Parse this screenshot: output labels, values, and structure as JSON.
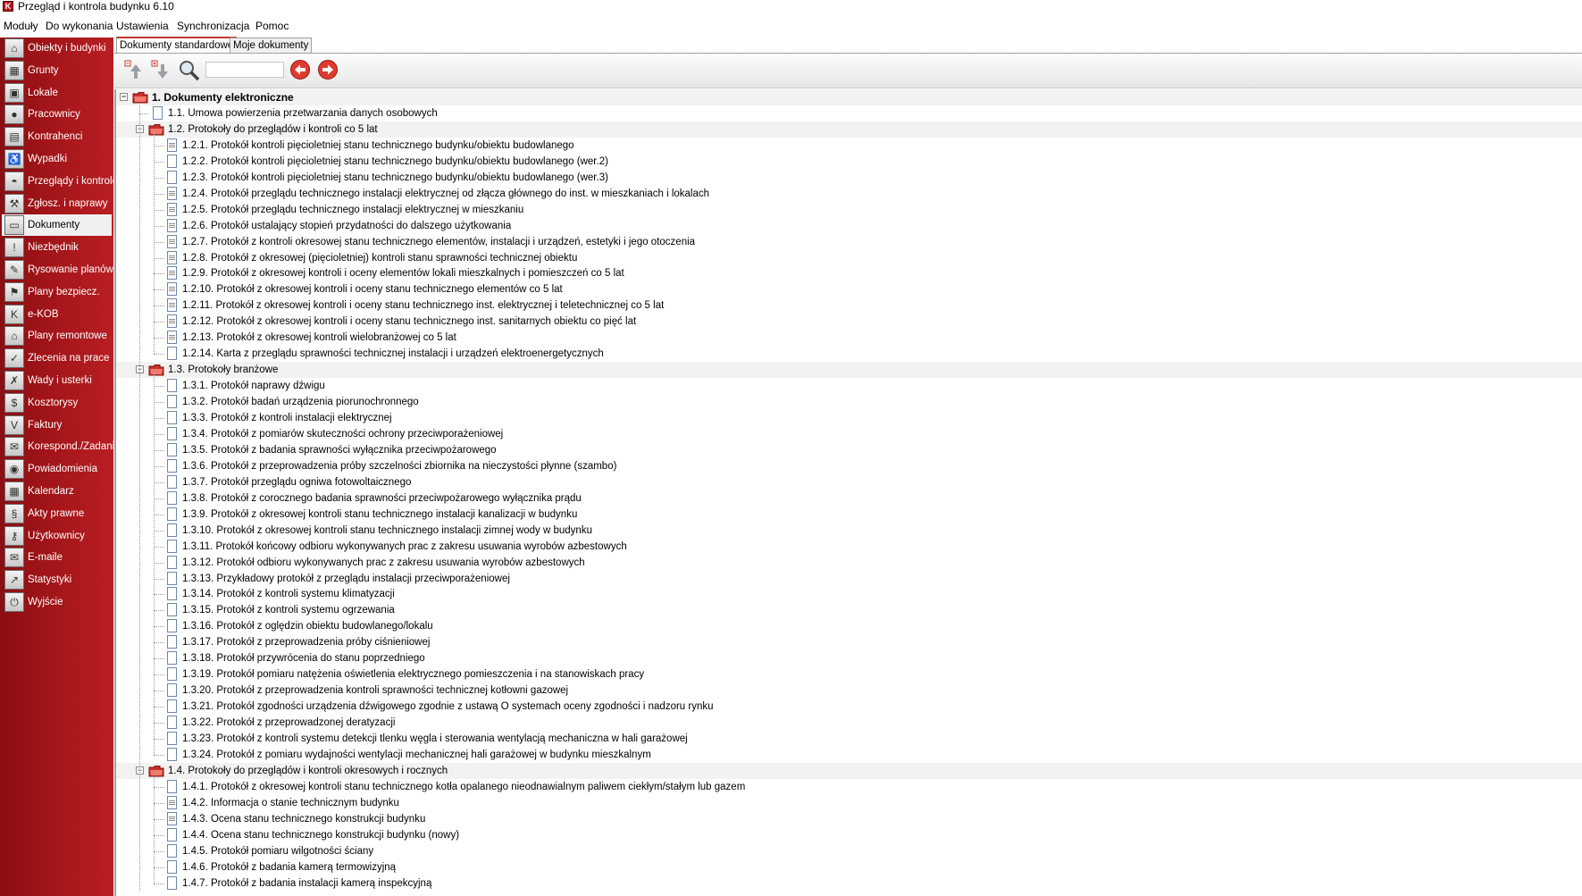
{
  "window": {
    "title": "Przegląd i kontrola budynku  6.10",
    "icon": "app-logo-icon"
  },
  "menu": [
    "Moduły",
    "Do wykonania",
    "Ustawienia",
    "Synchronizacja",
    "Pomoc"
  ],
  "sidebar": {
    "items": [
      {
        "label": "Obiekty i budynki",
        "icon": "building-icon"
      },
      {
        "label": "Grunty",
        "icon": "land-icon"
      },
      {
        "label": "Lokale",
        "icon": "flat-icon"
      },
      {
        "label": "Pracownicy",
        "icon": "person-icon"
      },
      {
        "label": "Kontrahenci",
        "icon": "contractor-icon"
      },
      {
        "label": "Wypadki",
        "icon": "wheelchair-icon"
      },
      {
        "label": "Przeglądy i kontrole",
        "icon": "helmet-icon"
      },
      {
        "label": "Zgłosz. i naprawy",
        "icon": "wrench-icon"
      },
      {
        "label": "Dokumenty",
        "icon": "document-icon",
        "active": true
      },
      {
        "label": "Niezbędnik",
        "icon": "exclamation-book-icon"
      },
      {
        "label": "Rysowanie planów",
        "icon": "drawing-icon"
      },
      {
        "label": "Plany bezpiecz.",
        "icon": "safety-plan-icon"
      },
      {
        "label": "e-KOB",
        "icon": "ekob-icon"
      },
      {
        "label": "Plany remontowe",
        "icon": "renovation-icon"
      },
      {
        "label": "Zlecenia na prace",
        "icon": "work-order-icon"
      },
      {
        "label": "Wady i usterki",
        "icon": "defect-icon"
      },
      {
        "label": "Kosztorysy",
        "icon": "dollar-icon"
      },
      {
        "label": "Faktury",
        "icon": "invoice-icon"
      },
      {
        "label": "Korespond./Zadania",
        "icon": "envelope-icon"
      },
      {
        "label": "Powiadomienia",
        "icon": "notification-icon"
      },
      {
        "label": "Kalendarz",
        "icon": "calendar-icon"
      },
      {
        "label": "Akty prawne",
        "icon": "paragraph-icon"
      },
      {
        "label": "Użytkownicy",
        "icon": "key-icon"
      },
      {
        "label": "E-maile",
        "icon": "email-icon"
      },
      {
        "label": "Statystyki",
        "icon": "chart-icon"
      },
      {
        "label": "Wyjście",
        "icon": "power-icon"
      }
    ]
  },
  "tabs": [
    {
      "label": "Dokumenty standardowe",
      "active": true
    },
    {
      "label": "Moje dokumenty",
      "active": false
    }
  ],
  "toolbar": {
    "buttons": [
      "expand-up-icon",
      "collapse-down-icon",
      "search-icon"
    ],
    "search_value": "",
    "nav": [
      "back-arrow-icon",
      "forward-arrow-icon"
    ]
  },
  "tree": [
    {
      "level": 1,
      "text": "1. Dokumenty elektroniczne",
      "type": "folder"
    },
    {
      "level": 2,
      "text": "1.1. Umowa powierzenia przetwarzania danych osobowych",
      "type": "doc"
    },
    {
      "level": 2,
      "text": "1.2. Protokoły do przeglądów i kontroli co 5 lat",
      "type": "folder"
    },
    {
      "level": 3,
      "text": "1.2.1. Protokół kontroli pięcioletniej stanu technicznego budynku/obiektu budowlanego",
      "type": "docf"
    },
    {
      "level": 3,
      "text": "1.2.2. Protokół kontroli pięcioletniej stanu technicznego budynku/obiektu budowlanego (wer.2)",
      "type": "doc"
    },
    {
      "level": 3,
      "text": "1.2.3. Protokół kontroli pięcioletniej stanu technicznego budynku/obiektu budowlanego (wer.3)",
      "type": "doc"
    },
    {
      "level": 3,
      "text": "1.2.4. Protokół przeglądu technicznego instalacji elektrycznej od złącza głównego do inst. w mieszkaniach i lokalach",
      "type": "docf"
    },
    {
      "level": 3,
      "text": "1.2.5. Protokół przeglądu technicznego instalacji elektrycznej w mieszkaniu",
      "type": "docf"
    },
    {
      "level": 3,
      "text": "1.2.6. Protokół ustalający stopień przydatności do dalszego użytkowania",
      "type": "docf"
    },
    {
      "level": 3,
      "text": "1.2.7. Protokół z kontroli okresowej stanu technicznego elementów, instalacji i urządzeń, estetyki i jego otoczenia",
      "type": "docf"
    },
    {
      "level": 3,
      "text": "1.2.8. Protokół z okresowej (pięcioletniej) kontroli stanu sprawności technicznej obiektu",
      "type": "docf"
    },
    {
      "level": 3,
      "text": "1.2.9. Protokół z okresowej kontroli i oceny elementów lokali mieszkalnych i pomieszczeń co 5 lat",
      "type": "docf"
    },
    {
      "level": 3,
      "text": "1.2.10. Protokół z okresowej kontroli i oceny stanu technicznego elementów co 5 lat",
      "type": "docf"
    },
    {
      "level": 3,
      "text": "1.2.11. Protokół z okresowej kontroli i oceny stanu technicznego inst. elektrycznej i teletechnicznej co 5 lat",
      "type": "docf"
    },
    {
      "level": 3,
      "text": "1.2.12. Protokół z okresowej kontroli i oceny stanu technicznego inst. sanitarnych obiektu co pięć lat",
      "type": "docf"
    },
    {
      "level": 3,
      "text": "1.2.13. Protokół z okresowej kontroli wielobranżowej co 5 lat",
      "type": "docf"
    },
    {
      "level": 3,
      "text": "1.2.14. Karta z przeglądu sprawności technicznej instalacji i urządzeń elektroenergetycznych",
      "type": "doc"
    },
    {
      "level": 2,
      "text": "1.3. Protokoły branżowe",
      "type": "folder"
    },
    {
      "level": 3,
      "text": "1.3.1. Protokół naprawy dźwigu",
      "type": "doc"
    },
    {
      "level": 3,
      "text": "1.3.2. Protokół badań urządzenia piorunochronnego",
      "type": "doc"
    },
    {
      "level": 3,
      "text": "1.3.3. Protokół z kontroli instalacji elektrycznej",
      "type": "doc"
    },
    {
      "level": 3,
      "text": "1.3.4. Protokół z pomiarów skuteczności ochrony przeciwporażeniowej",
      "type": "doc"
    },
    {
      "level": 3,
      "text": "1.3.5. Protokół z badania sprawności wyłącznika przeciwpożarowego",
      "type": "doc"
    },
    {
      "level": 3,
      "text": "1.3.6. Protokół z przeprowadzenia próby szczelności zbiornika na nieczystości płynne (szambo)",
      "type": "doc"
    },
    {
      "level": 3,
      "text": "1.3.7. Protokół przeglądu ogniwa fotowoltaicznego",
      "type": "doc"
    },
    {
      "level": 3,
      "text": "1.3.8. Protokół z corocznego badania sprawności przeciwpożarowego wyłącznika prądu",
      "type": "doc"
    },
    {
      "level": 3,
      "text": "1.3.9. Protokół z okresowej kontroli stanu technicznego instalacji kanalizacji w budynku",
      "type": "doc"
    },
    {
      "level": 3,
      "text": "1.3.10. Protokół z okresowej kontroli stanu technicznego instalacji zimnej wody w budynku",
      "type": "doc"
    },
    {
      "level": 3,
      "text": "1.3.11. Protokół końcowy odbioru wykonywanych prac z zakresu usuwania wyrobów azbestowych",
      "type": "doc"
    },
    {
      "level": 3,
      "text": "1.3.12. Protokół odbioru wykonywanych prac z zakresu usuwania wyrobów azbestowych",
      "type": "doc"
    },
    {
      "level": 3,
      "text": "1.3.13. Przykładowy protokół z przeglądu instalacji przeciwporażeniowej",
      "type": "doc"
    },
    {
      "level": 3,
      "text": "1.3.14. Protokół z kontroli systemu klimatyzacji",
      "type": "doc"
    },
    {
      "level": 3,
      "text": "1.3.15. Protokół z kontroli systemu ogrzewania",
      "type": "doc"
    },
    {
      "level": 3,
      "text": "1.3.16. Protokół z oględzin obiektu budowlanego/lokalu",
      "type": "doc"
    },
    {
      "level": 3,
      "text": "1.3.17. Protokół z przeprowadzenia próby ciśnieniowej",
      "type": "doc"
    },
    {
      "level": 3,
      "text": "1.3.18. Protokół przywrócenia do stanu poprzedniego",
      "type": "doc"
    },
    {
      "level": 3,
      "text": "1.3.19. Protokół pomiaru natężenia oświetlenia elektrycznego  pomieszczenia i na stanowiskach pracy",
      "type": "doc"
    },
    {
      "level": 3,
      "text": "1.3.20. Protokół z przeprowadzenia kontroli sprawności technicznej kotłowni gazowej",
      "type": "doc"
    },
    {
      "level": 3,
      "text": "1.3.21. Protokół zgodności urządzenia dźwigowego zgodnie z ustawą O systemach oceny zgodności i nadzoru rynku",
      "type": "doc"
    },
    {
      "level": 3,
      "text": "1.3.22. Protokół z przeprowadzonej deratyzacji",
      "type": "doc"
    },
    {
      "level": 3,
      "text": "1.3.23. Protokół z kontroli  systemu detekcji  tlenku węgla i sterowania wentylacją mechaniczna w hali garażowej",
      "type": "doc"
    },
    {
      "level": 3,
      "text": "1.3.24. Protokół z pomiaru wydajności wentylacji mechanicznej hali garażowej w budynku mieszkalnym",
      "type": "doc"
    },
    {
      "level": 2,
      "text": "1.4. Protokoły do przeglądów i kontroli okresowych i rocznych",
      "type": "folder"
    },
    {
      "level": 3,
      "text": "1.4.1. Protokół z okresowej kontroli stanu technicznego kotła opalanego nieodnawialnym paliwem ciekłym/stałym lub gazem",
      "type": "doc"
    },
    {
      "level": 3,
      "text": "1.4.2. Informacja o stanie technicznym budynku",
      "type": "docf"
    },
    {
      "level": 3,
      "text": "1.4.3. Ocena stanu technicznego konstrukcji budynku",
      "type": "docf"
    },
    {
      "level": 3,
      "text": "1.4.4. Ocena stanu technicznego konstrukcji budynku (nowy)",
      "type": "doc"
    },
    {
      "level": 3,
      "text": "1.4.5. Protokół pomiaru wilgotności ściany",
      "type": "doc"
    },
    {
      "level": 3,
      "text": "1.4.6. Protokół z badania kamerą termowizyjną",
      "type": "doc"
    },
    {
      "level": 3,
      "text": "1.4.7. Protokół z badania instalacji kamerą inspekcyjną",
      "type": "doc"
    }
  ]
}
